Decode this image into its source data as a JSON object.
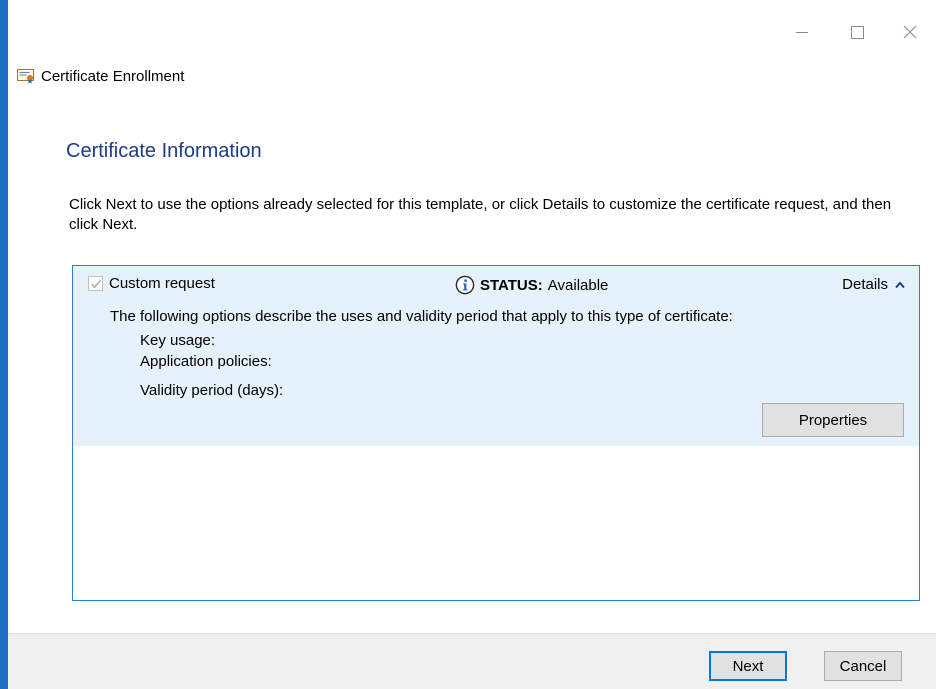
{
  "window": {
    "title": "Certificate Enrollment"
  },
  "page": {
    "heading": "Certificate Information",
    "instructions": "Click Next to use the options already selected for this template, or click Details to customize the certificate request, and then click Next."
  },
  "request": {
    "checkbox_label": "Custom request",
    "checked": true,
    "status_label": "STATUS:",
    "status_value": "Available",
    "details_label": "Details",
    "description": "The following options describe the uses and validity period that apply to this type of certificate:",
    "key_usage_label": "Key usage:",
    "app_policies_label": "Application policies:",
    "validity_label": "Validity period (days):",
    "properties_button": "Properties"
  },
  "footer": {
    "next_button": "Next",
    "cancel_button": "Cancel"
  },
  "icons": {
    "window": "certificate-icon",
    "status": "info-icon",
    "details": "chevron-up-icon"
  },
  "colors": {
    "accent": "#0078d7",
    "heading": "#1e3a8a",
    "entry_background": "#e6f2fb",
    "footer_background": "#f0f0f0"
  }
}
